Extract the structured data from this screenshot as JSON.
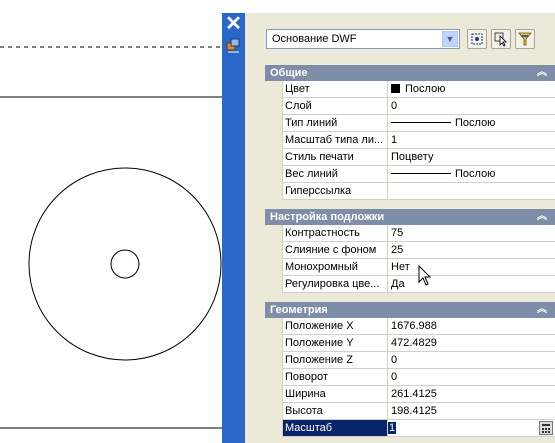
{
  "panel": {
    "close_glyph": "✕",
    "object_type": "Основание DWF"
  },
  "toolbar_icons": [
    "quick-select-icon",
    "select-objects-icon",
    "toggle-pickadd-icon"
  ],
  "sections": {
    "general": {
      "title": "Общие",
      "rows": [
        {
          "name": "Цвет",
          "value": "Послою"
        },
        {
          "name": "Слой",
          "value": "0"
        },
        {
          "name": "Тип линий",
          "value": "Послою"
        },
        {
          "name": "Масштаб типа ли...",
          "value": "1"
        },
        {
          "name": "Стиль печати",
          "value": "Поцвету"
        },
        {
          "name": "Вес линий",
          "value": "Послою"
        },
        {
          "name": "Гиперссылка",
          "value": ""
        }
      ]
    },
    "underlay": {
      "title": "Настройка подложки",
      "rows": [
        {
          "name": "Контрастность",
          "value": "75"
        },
        {
          "name": "Слияние с фоном",
          "value": "25"
        },
        {
          "name": "Монохромный",
          "value": "Нет"
        },
        {
          "name": "Регулировка цве...",
          "value": "Да"
        }
      ]
    },
    "geometry": {
      "title": "Геометрия",
      "rows": [
        {
          "name": "Положение X",
          "value": "1676.988"
        },
        {
          "name": "Положение Y",
          "value": "472.4829"
        },
        {
          "name": "Положение Z",
          "value": "0"
        },
        {
          "name": "Поворот",
          "value": "0"
        },
        {
          "name": "Ширина",
          "value": "261.4125"
        },
        {
          "name": "Высота",
          "value": "198.4125"
        },
        {
          "name": "Масштаб",
          "value": "1"
        }
      ]
    }
  },
  "colors": {
    "titlebar": "#2a67c8",
    "section_header": "#7e8ea8",
    "selection": "#0a246a"
  }
}
